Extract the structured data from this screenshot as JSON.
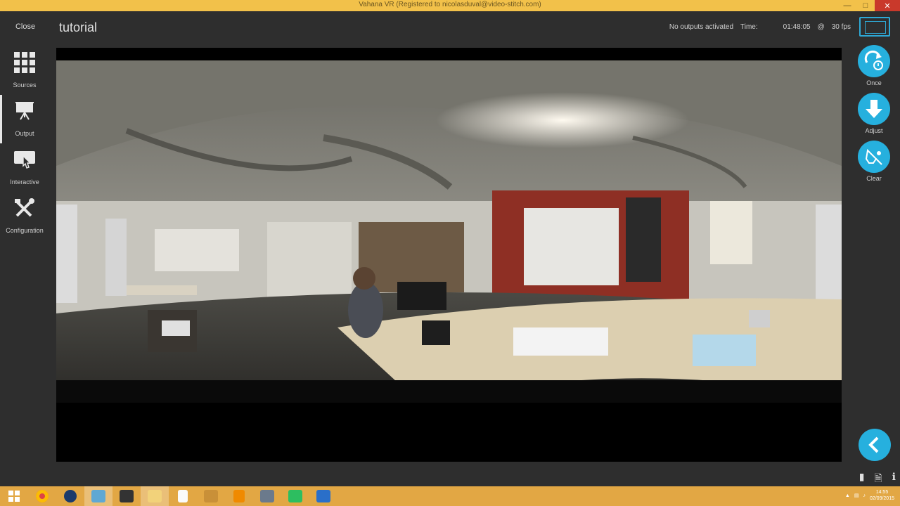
{
  "window": {
    "title": "Vahana VR (Registered to nicolasduval@video-stitch.com)"
  },
  "header": {
    "close_label": "Close",
    "project_title": "tutorial",
    "outputs_status": "No outputs activated",
    "time_label": "Time:",
    "time_value": "01:48:05",
    "at": "@",
    "fps": "30 fps"
  },
  "sidebar": {
    "items": [
      {
        "label": "Sources",
        "icon": "grid-icon"
      },
      {
        "label": "Output",
        "icon": "projector-icon"
      },
      {
        "label": "Interactive",
        "icon": "pointer-icon"
      },
      {
        "label": "Configuration",
        "icon": "tools-icon"
      }
    ]
  },
  "actions": [
    {
      "label": "Once",
      "icon": "rotate-timer-icon"
    },
    {
      "label": "Adjust",
      "icon": "arrow-down-icon"
    },
    {
      "label": "Clear",
      "icon": "eraser-icon"
    }
  ],
  "taskbar": {
    "clock_time": "14:55",
    "clock_date": "02/09/2015",
    "apps": [
      "windows-start",
      "chrome",
      "steam",
      "vahana-vr",
      "audio-app",
      "file-explorer",
      "blank-doc",
      "media",
      "vlc",
      "network",
      "evernote",
      "mail"
    ]
  },
  "colors": {
    "accent": "#26b0de",
    "titlebar": "#f2c14a",
    "taskbar": "#e2a744",
    "app_bg": "#2e2e2e"
  }
}
